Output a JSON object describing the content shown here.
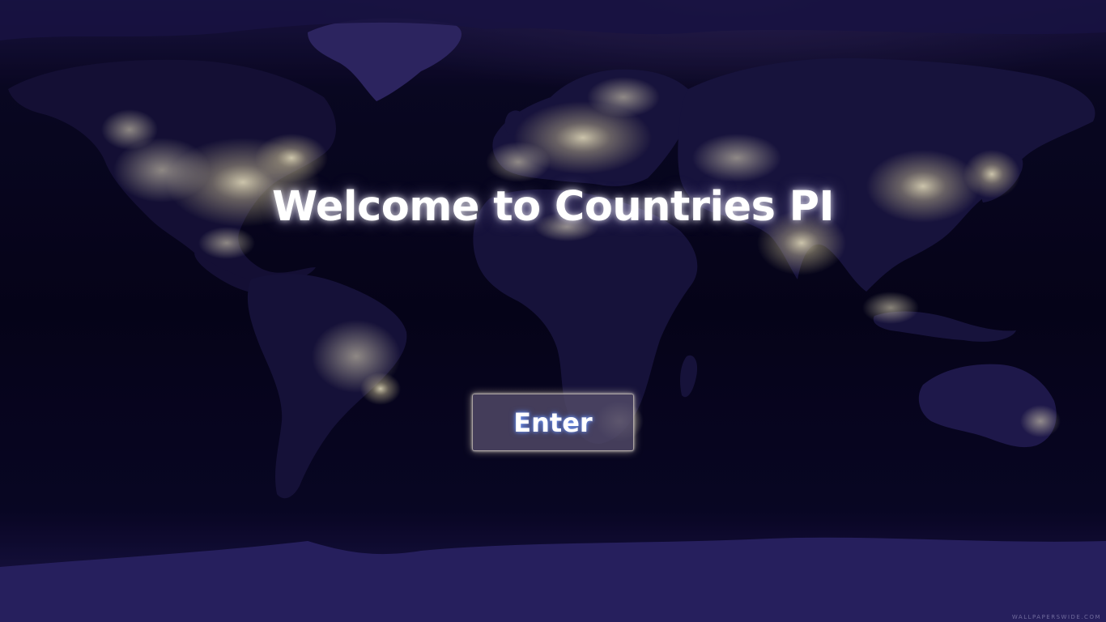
{
  "title": "Welcome to Countries PI",
  "enter_button": {
    "label": "Enter"
  },
  "background": {
    "image": "night-earth-city-lights-map",
    "watermark": "WALLPAPERSWIDE.COM"
  },
  "colors": {
    "title": "#ffffff",
    "button_bg": "#524a68",
    "ocean": "#06041a",
    "land": "#17123a",
    "ice": "#3a3070",
    "city_lights": "#fff3c4"
  }
}
